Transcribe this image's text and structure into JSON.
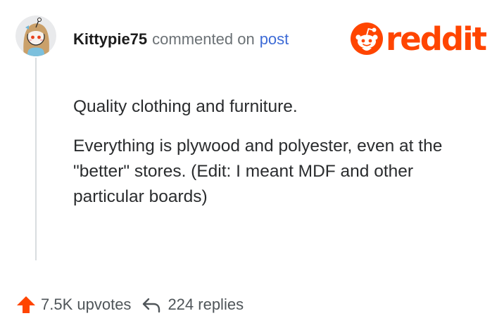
{
  "comment": {
    "username": "Kittypie75",
    "action_text": "commented on",
    "post_link_text": "post",
    "paragraphs": [
      "Quality clothing and furniture.",
      "Everything is plywood and polyester, even at the \"better\" stores. (Edit: I meant MDF and other particular boards)"
    ]
  },
  "brand": {
    "wordmark": "reddit",
    "color": "#ff4500",
    "icon": "reddit-snoo-icon"
  },
  "footer": {
    "upvotes_label": "7.5K upvotes",
    "replies_label": "224 replies",
    "upvote_icon": "upvote-arrow-icon",
    "reply_icon": "reply-arrow-icon"
  },
  "colors": {
    "link": "#3d6bd6",
    "muted": "#6b7175",
    "thread_line": "#d9dde0"
  }
}
